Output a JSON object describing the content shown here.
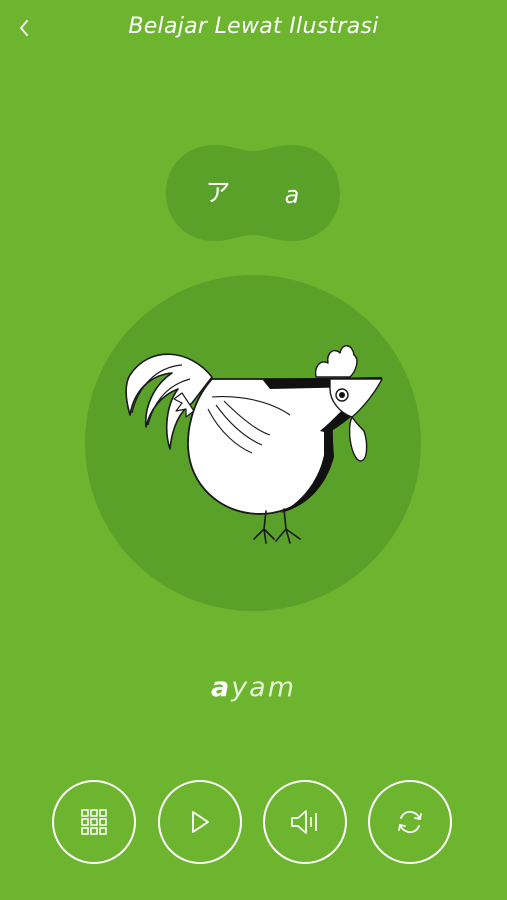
{
  "header": {
    "title": "Belajar Lewat Ilustrasi",
    "back_icon": "chevron-left-icon"
  },
  "character": {
    "kana": "ア",
    "romaji": "a"
  },
  "illustration": {
    "subject": "rooster-icon"
  },
  "word": {
    "highlight": "a",
    "rest": "yam"
  },
  "controls": [
    {
      "icon": "grid-icon"
    },
    {
      "icon": "play-icon"
    },
    {
      "icon": "speaker-icon"
    },
    {
      "icon": "refresh-icon"
    }
  ],
  "colors": {
    "background": "#6db52f",
    "circle": "#5aa12a",
    "text": "#ffffff"
  }
}
